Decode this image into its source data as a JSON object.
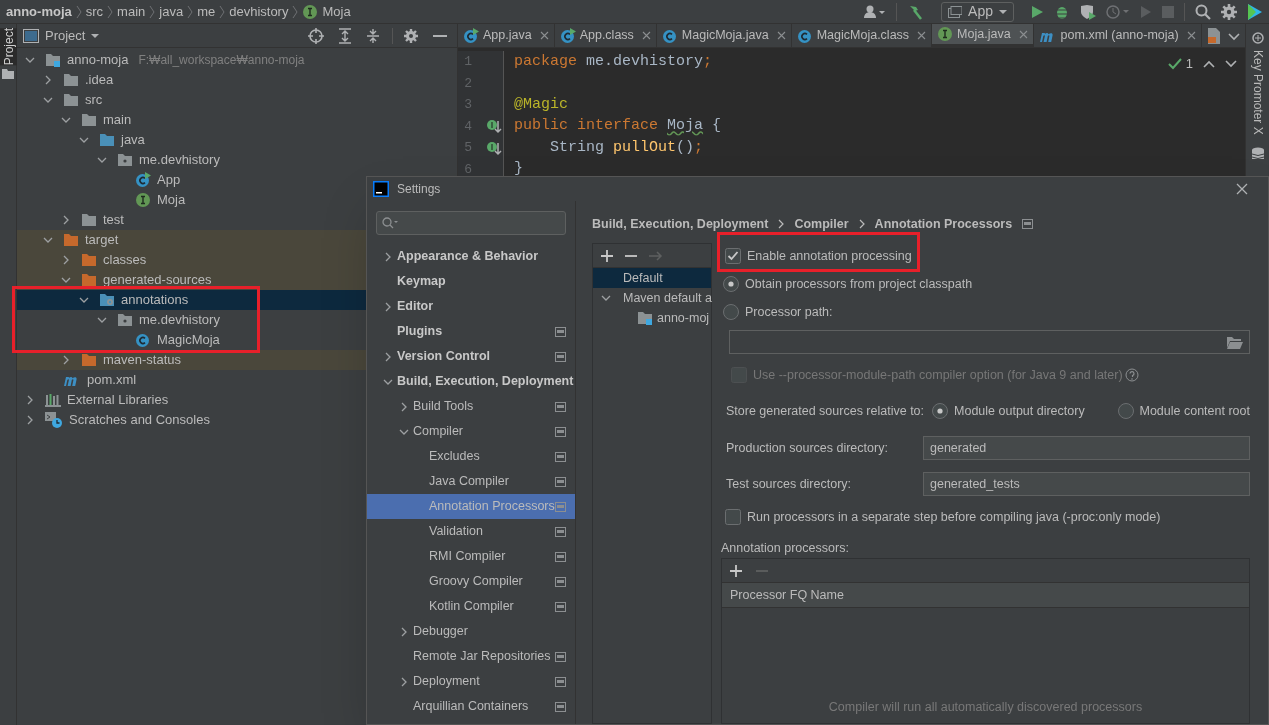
{
  "breadcrumbs": [
    {
      "label": "anno-moja",
      "kind": "project"
    },
    {
      "label": "src",
      "kind": "plain"
    },
    {
      "label": "main",
      "kind": "plain"
    },
    {
      "label": "java",
      "kind": "plain"
    },
    {
      "label": "me",
      "kind": "plain"
    },
    {
      "label": "devhistory",
      "kind": "plain"
    },
    {
      "label": "Moja",
      "kind": "interface"
    }
  ],
  "toolbar": {
    "run_config": "App"
  },
  "left_strip": {
    "tab": "Project"
  },
  "project_panel": {
    "title": "Project",
    "tree": [
      {
        "label": "anno-moja",
        "hint": "F:₩all_workspace₩anno-moja",
        "kind": "module",
        "expanded": true,
        "selected": false,
        "children": [
          {
            "label": ".idea",
            "kind": "folder",
            "expanded": false,
            "selected": false
          },
          {
            "label": "src",
            "kind": "folder",
            "expanded": true,
            "selected": false,
            "children": [
              {
                "label": "main",
                "kind": "folder",
                "expanded": true,
                "selected": false,
                "children": [
                  {
                    "label": "java",
                    "kind": "source-root",
                    "expanded": true,
                    "selected": false,
                    "children": [
                      {
                        "label": "me.devhistory",
                        "kind": "package",
                        "expanded": true,
                        "selected": false,
                        "children": [
                          {
                            "label": "App",
                            "kind": "class-run",
                            "selected": false
                          },
                          {
                            "label": "Moja",
                            "kind": "interface",
                            "selected": false
                          }
                        ]
                      }
                    ]
                  }
                ]
              },
              {
                "label": "test",
                "kind": "folder",
                "expanded": false,
                "selected": false
              }
            ]
          },
          {
            "label": "target",
            "kind": "excluded",
            "expanded": true,
            "selected": false,
            "children": [
              {
                "label": "classes",
                "kind": "excluded",
                "expanded": false,
                "selected": false
              },
              {
                "label": "generated-sources",
                "kind": "excluded",
                "expanded": true,
                "selected": false,
                "children": [
                  {
                    "label": "annotations",
                    "kind": "generated-root",
                    "expanded": true,
                    "selected": true,
                    "marked": true,
                    "children": [
                      {
                        "label": "me.devhistory",
                        "kind": "package",
                        "expanded": true,
                        "selected": false,
                        "children": [
                          {
                            "label": "MagicMoja",
                            "kind": "class",
                            "selected": false
                          }
                        ]
                      }
                    ]
                  }
                ]
              },
              {
                "label": "maven-status",
                "kind": "excluded",
                "expanded": false,
                "selected": false
              }
            ]
          },
          {
            "label": "pom.xml",
            "kind": "maven",
            "selected": false
          }
        ]
      },
      {
        "label": "External Libraries",
        "kind": "libraries",
        "expanded": false,
        "selected": false
      },
      {
        "label": "Scratches and Consoles",
        "kind": "scratches",
        "expanded": false,
        "selected": false
      }
    ]
  },
  "editor": {
    "tabs": [
      {
        "label": "App.java",
        "kind": "class-run",
        "selected": false
      },
      {
        "label": "App.class",
        "kind": "class-run",
        "selected": false
      },
      {
        "label": "MagicMoja.java",
        "kind": "class",
        "selected": false
      },
      {
        "label": "MagicMoja.class",
        "kind": "class",
        "selected": false
      },
      {
        "label": "Moja.java",
        "kind": "interface",
        "selected": true
      },
      {
        "label": "pom.xml (anno-moja)",
        "kind": "maven",
        "selected": false
      }
    ],
    "inspection_count": "1",
    "lines": [
      {
        "number": "1",
        "implemented": false,
        "tokens": [
          {
            "kind": "keyword",
            "text": "package"
          },
          {
            "kind": "plain",
            "text": " me.devhistory"
          },
          {
            "kind": "punct",
            "text": ";"
          }
        ]
      },
      {
        "number": "2",
        "implemented": false
      },
      {
        "number": "3",
        "implemented": false,
        "tokens": [
          {
            "kind": "annotation",
            "text": "@Magic"
          }
        ]
      },
      {
        "number": "4",
        "implemented": true,
        "tokens": [
          {
            "kind": "keyword",
            "text": "public interface "
          },
          {
            "kind": "typo",
            "text": "Moja"
          },
          {
            "kind": "plain",
            "text": " {"
          }
        ]
      },
      {
        "number": "5",
        "implemented": true,
        "tokens": [
          {
            "kind": "plain",
            "text": "    String "
          },
          {
            "kind": "method",
            "text": "pullOut"
          },
          {
            "kind": "plain",
            "text": "()"
          },
          {
            "kind": "punct",
            "text": ";"
          }
        ]
      },
      {
        "number": "6",
        "implemented": false,
        "tokens": [
          {
            "kind": "plain",
            "text": "}"
          }
        ]
      }
    ]
  },
  "right_strip": {
    "tab": "Key Promoter X"
  },
  "settings": {
    "title": "Settings",
    "nav": [
      {
        "label": "Appearance & Behavior",
        "expanded": false,
        "project_level": false,
        "selected": false
      },
      {
        "label": "Keymap",
        "project_level": false,
        "selected": false
      },
      {
        "label": "Editor",
        "expanded": false,
        "project_level": false,
        "selected": false
      },
      {
        "label": "Plugins",
        "project_level": true,
        "selected": false
      },
      {
        "label": "Version Control",
        "expanded": false,
        "project_level": true,
        "selected": false
      },
      {
        "label": "Build, Execution, Deployment",
        "expanded": true,
        "project_level": false,
        "selected": false,
        "children": [
          {
            "label": "Build Tools",
            "expanded": false,
            "project_level": true,
            "selected": false
          },
          {
            "label": "Compiler",
            "expanded": true,
            "project_level": true,
            "selected": false,
            "children": [
              {
                "label": "Excludes",
                "project_level": true,
                "selected": false
              },
              {
                "label": "Java Compiler",
                "project_level": true,
                "selected": false
              },
              {
                "label": "Annotation Processors",
                "project_level": true,
                "selected": true
              },
              {
                "label": "Validation",
                "project_level": true,
                "selected": false
              },
              {
                "label": "RMI Compiler",
                "project_level": true,
                "selected": false
              },
              {
                "label": "Groovy Compiler",
                "project_level": true,
                "selected": false
              },
              {
                "label": "Kotlin Compiler",
                "project_level": true,
                "selected": false
              }
            ]
          },
          {
            "label": "Debugger",
            "expanded": false,
            "project_level": false,
            "selected": false
          },
          {
            "label": "Remote Jar Repositories",
            "project_level": true,
            "selected": false
          },
          {
            "label": "Deployment",
            "expanded": false,
            "project_level": true,
            "selected": false
          },
          {
            "label": "Arquillian Containers",
            "project_level": true,
            "selected": false
          }
        ]
      }
    ],
    "path": [
      "Build, Execution, Deployment",
      "Compiler",
      "Annotation Processors"
    ],
    "profiles": [
      {
        "label": "Default",
        "selected": true
      },
      {
        "label": "Maven default a",
        "expanded": true,
        "selected": false,
        "children": [
          {
            "label": "anno-moj",
            "selected": false
          }
        ]
      }
    ],
    "options": [
      {
        "kind": "checkbox",
        "label": "Enable annotation processing",
        "checked": true,
        "disabled": false,
        "marked": true
      },
      {
        "kind": "radio",
        "label": "Obtain processors from project classpath",
        "selected": true
      },
      {
        "kind": "radio",
        "label": "Processor path:",
        "selected": false
      },
      {
        "kind": "path-field"
      },
      {
        "kind": "checkbox",
        "label": "Use --processor-module-path compiler option (for Java 9 and later)",
        "checked": false,
        "disabled": true,
        "marked": false
      },
      {
        "kind": "radio-row",
        "label": "Store generated sources relative to:",
        "choices": [
          {
            "label": "Module output directory",
            "selected": true
          },
          {
            "label": "Module content root",
            "selected": false
          }
        ]
      },
      {
        "kind": "text-field",
        "label": "Production sources directory:",
        "value": "generated"
      },
      {
        "kind": "text-field",
        "label": "Test sources directory:",
        "value": "generated_tests"
      },
      {
        "kind": "checkbox",
        "label": "Run processors in a separate step before compiling java (-proc:only mode)",
        "checked": false,
        "disabled": false,
        "marked": false
      },
      {
        "kind": "table",
        "label": "Annotation processors:",
        "columns": [
          "Processor FQ Name"
        ],
        "empty_text": "Compiler will run all automatically discovered processors"
      }
    ]
  }
}
